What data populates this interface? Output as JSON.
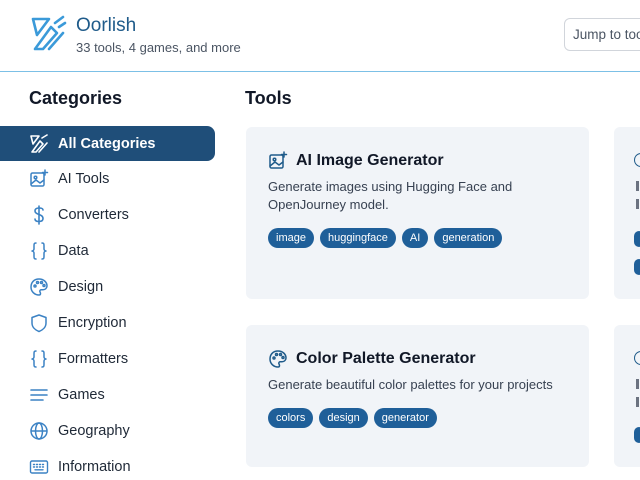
{
  "header": {
    "title": "Oorlish",
    "subtitle": "33 tools, 4 games, and more",
    "search_placeholder": "Jump to tool"
  },
  "sidebar": {
    "title": "Categories",
    "items": [
      {
        "label": "All Categories",
        "icon": "logo-icon",
        "active": true
      },
      {
        "label": "AI Tools",
        "icon": "image-sparkle-icon"
      },
      {
        "label": "Converters",
        "icon": "dollar-icon"
      },
      {
        "label": "Data",
        "icon": "braces-icon"
      },
      {
        "label": "Design",
        "icon": "palette-icon"
      },
      {
        "label": "Encryption",
        "icon": "shield-icon"
      },
      {
        "label": "Formatters",
        "icon": "braces-icon"
      },
      {
        "label": "Games",
        "icon": "menu-lines-icon"
      },
      {
        "label": "Geography",
        "icon": "globe-icon"
      },
      {
        "label": "Information",
        "icon": "keyboard-icon"
      }
    ]
  },
  "main": {
    "title": "Tools",
    "cards": [
      {
        "title": "AI Image Generator",
        "icon": "image-sparkle-icon",
        "description": "Generate images using Hugging Face and OpenJourney model.",
        "tags": [
          "image",
          "huggingface",
          "AI",
          "generation"
        ]
      },
      {
        "title": "Color Palette Generator",
        "icon": "palette-icon",
        "description": "Generate beautiful color palettes for your projects",
        "tags": [
          "colors",
          "design",
          "generator"
        ]
      }
    ]
  },
  "colors": {
    "accent": "#1f4e79",
    "tag": "#1f5f99",
    "card_bg": "#f1f4f8",
    "header_border": "#7cc0e6"
  }
}
